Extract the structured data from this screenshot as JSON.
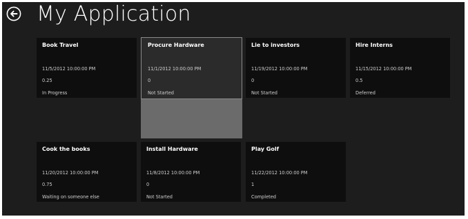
{
  "app": {
    "title": "My Application",
    "back_icon": "back-arrow-icon"
  },
  "colors": {
    "background": "#1d1d1d",
    "tile": "#0e0e0e",
    "tile_selected": "#2b2b2b",
    "selection_extension": "#6b6b6b"
  },
  "tasks": [
    {
      "title": "Book Travel",
      "date": "11/5/2012 10:00:00 PM",
      "value": "0.25",
      "status": "In Progress"
    },
    {
      "title": "Procure Hardware",
      "date": "11/1/2012 10:00:00 PM",
      "value": "0",
      "status": "Not Started",
      "selected": true
    },
    {
      "title": "Lie to investors",
      "date": "11/19/2012 10:00:00 PM",
      "value": "0",
      "status": "Not Started"
    },
    {
      "title": "Hire Interns",
      "date": "11/15/2012 10:00:00 PM",
      "value": "0.5",
      "status": "Deferred"
    },
    {
      "title": "Cook the books",
      "date": "11/20/2012 10:00:00 PM",
      "value": "0.75",
      "status": "Waiting on someone else"
    },
    {
      "title": "Install Hardware",
      "date": "11/8/2012 10:00:00 PM",
      "value": "0",
      "status": "Not Started"
    },
    {
      "title": "Play Golf",
      "date": "11/22/2012 10:00:00 PM",
      "value": "1",
      "status": "Completed"
    }
  ]
}
